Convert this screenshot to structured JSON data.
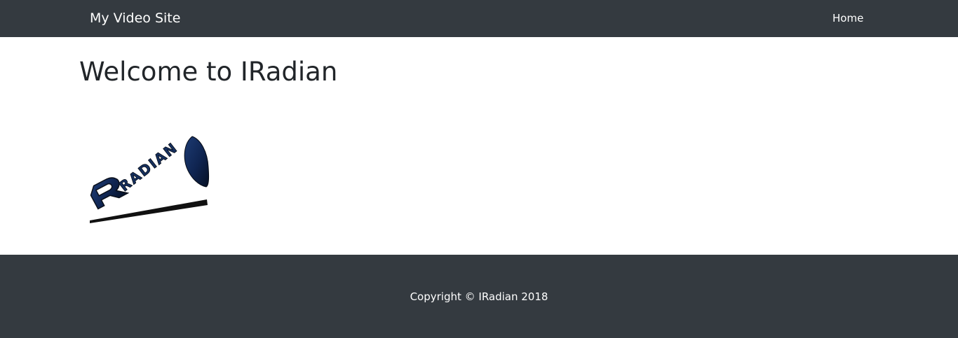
{
  "navbar": {
    "brand": "My Video Site",
    "links": [
      {
        "label": "Home"
      }
    ],
    "background": "#343a40"
  },
  "main": {
    "title": "Welcome to IRadian",
    "logo": {
      "name": "iradian-logo",
      "text": "RADIAN"
    }
  },
  "footer": {
    "copyright": "Copyright © IRadian 2018",
    "background": "#343a40"
  }
}
